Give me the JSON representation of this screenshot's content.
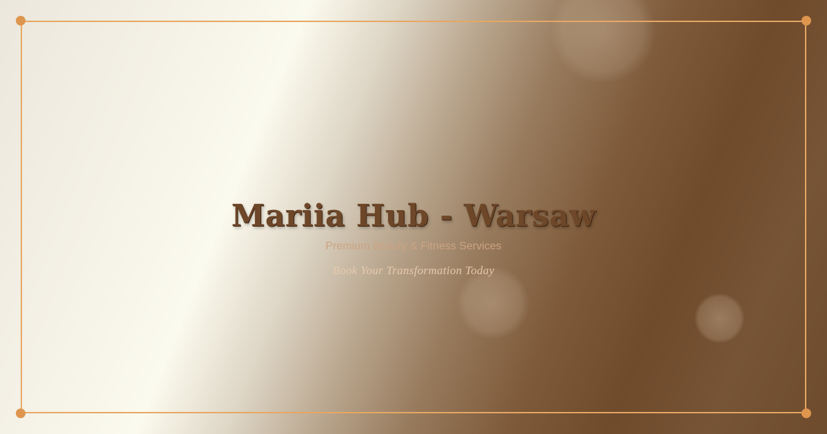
{
  "hero": {
    "title": "Mariia Hub - Warsaw",
    "subtitle": "Premium Beauty & Fitness Services",
    "tagline": "Book Your Transformation Today"
  },
  "colors": {
    "accent_frame": "#e7a763",
    "corner_dot": "#de954d",
    "title_text": "#6e4729",
    "gradient_light": "#fbfaee",
    "gradient_dark": "#6f4a2b"
  }
}
